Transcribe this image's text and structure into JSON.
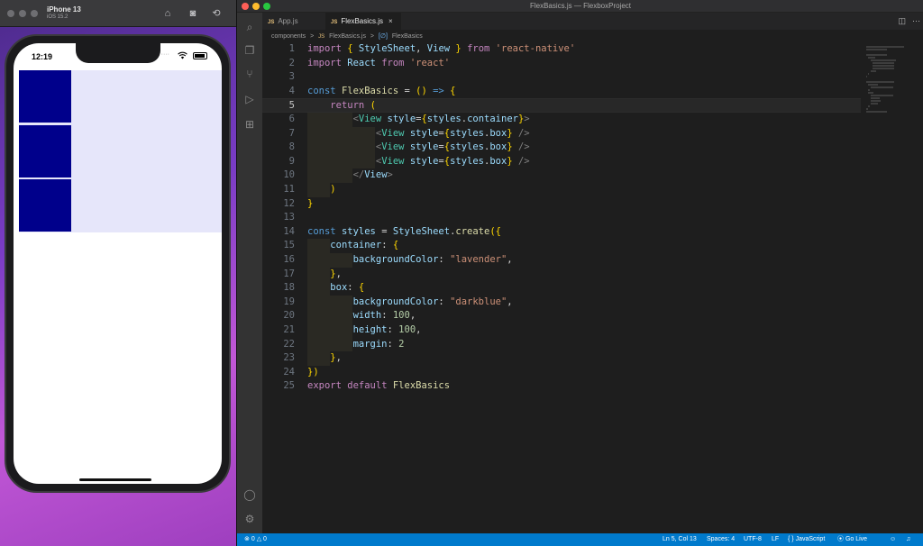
{
  "simulator": {
    "device": "iPhone 13",
    "os": "iOS 15.2",
    "toolbar_icons": [
      "home-icon",
      "screenshot-icon",
      "rotate-icon"
    ],
    "status_time": "12:19",
    "status_dots": "····",
    "battery_level": 0.9,
    "app": {
      "container_color": "lavender",
      "box_color": "darkblue",
      "box_count": 3
    }
  },
  "vscode": {
    "window_title": "FlexBasics.js — FlexboxProject",
    "tabs": [
      {
        "label": "App.js",
        "badge": "JS"
      },
      {
        "label": "FlexBasics.js",
        "badge": "JS"
      }
    ],
    "tab_close": "×",
    "breadcrumb": [
      "components",
      ">",
      "JS",
      "FlexBasics.js",
      ">",
      "[∅]",
      "FlexBasics"
    ],
    "activity_icons": [
      "explorer-icon",
      "search-icon",
      "source-control-icon",
      "run-debug-icon",
      "extensions-icon",
      "account-icon",
      "settings-icon"
    ],
    "current_line": 5,
    "code": [
      "import { StyleSheet, View } from 'react-native'",
      "import React from 'react'",
      "",
      "const FlexBasics = () => {",
      "    return (",
      "        <View style={styles.container}>",
      "            <View style={styles.box} />",
      "            <View style={styles.box} />",
      "            <View style={styles.box} />",
      "        </View>",
      "    )",
      "}",
      "",
      "const styles = StyleSheet.create({",
      "    container: {",
      "        backgroundColor: \"lavender\",",
      "    },",
      "    box: {",
      "        backgroundColor: \"darkblue\",",
      "        width: 100,",
      "        height: 100,",
      "        margin: 2",
      "    },",
      "})",
      "export default FlexBasics"
    ],
    "status_bar": {
      "errors": "0",
      "warnings": "0",
      "position": "Ln 5, Col 13",
      "spaces": "Spaces: 4",
      "encoding": "UTF-8",
      "eol": "LF",
      "language": "JavaScript",
      "go_live": "Go Live"
    }
  },
  "colors": {
    "lavender": "#e6e6fa",
    "darkblue": "#00008b",
    "status_bar": "#007acc",
    "editor_bg": "#1e1e1e"
  }
}
